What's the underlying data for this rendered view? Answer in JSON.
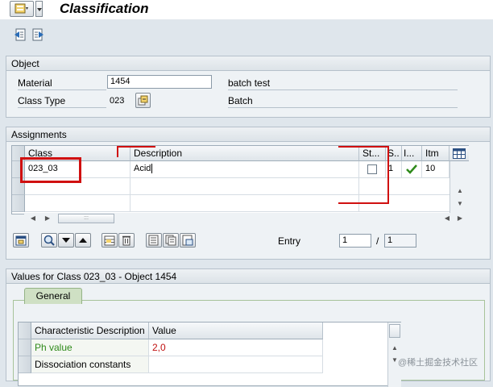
{
  "title": "Classification",
  "object": {
    "heading": "Object",
    "material_label": "Material",
    "material_value": "1454",
    "material_desc": "batch test",
    "class_type_label": "Class Type",
    "class_type_value": "023",
    "class_type_desc": "Batch"
  },
  "assignments": {
    "heading": "Assignments",
    "columns": [
      "Class",
      "Description",
      "St...",
      "S..",
      "I...",
      "Itm"
    ],
    "rows": [
      {
        "class": "023_03",
        "description": "Acid",
        "status": "1",
        "item": "10"
      }
    ],
    "entry_label": "Entry",
    "entry_value": "1",
    "entry_separator": "/",
    "entry_total": "1"
  },
  "values": {
    "heading": "Values for Class 023_03 - Object 1454",
    "tab_general": "General",
    "columns": [
      "Characteristic Description",
      "Value"
    ],
    "rows": [
      {
        "characteristic": "Ph value",
        "value": "2,0"
      },
      {
        "characteristic": "Dissociation constants",
        "value": ""
      }
    ]
  },
  "watermark": "@稀土掘金技术社区",
  "colors": {
    "highlight_red": "#d01010",
    "char_green": "#2f8a1b",
    "value_red": "#c01010",
    "tab_active": "#cfe0c4"
  },
  "icons": [
    "menu-icon",
    "prev-object-icon",
    "next-object-icon",
    "possible-entries-icon",
    "detail-icon",
    "find-icon",
    "move-down-icon",
    "move-up-icon",
    "insert-row-icon",
    "delete-row-icon",
    "copy-icon",
    "checkmark-icon",
    "table-settings-icon"
  ]
}
